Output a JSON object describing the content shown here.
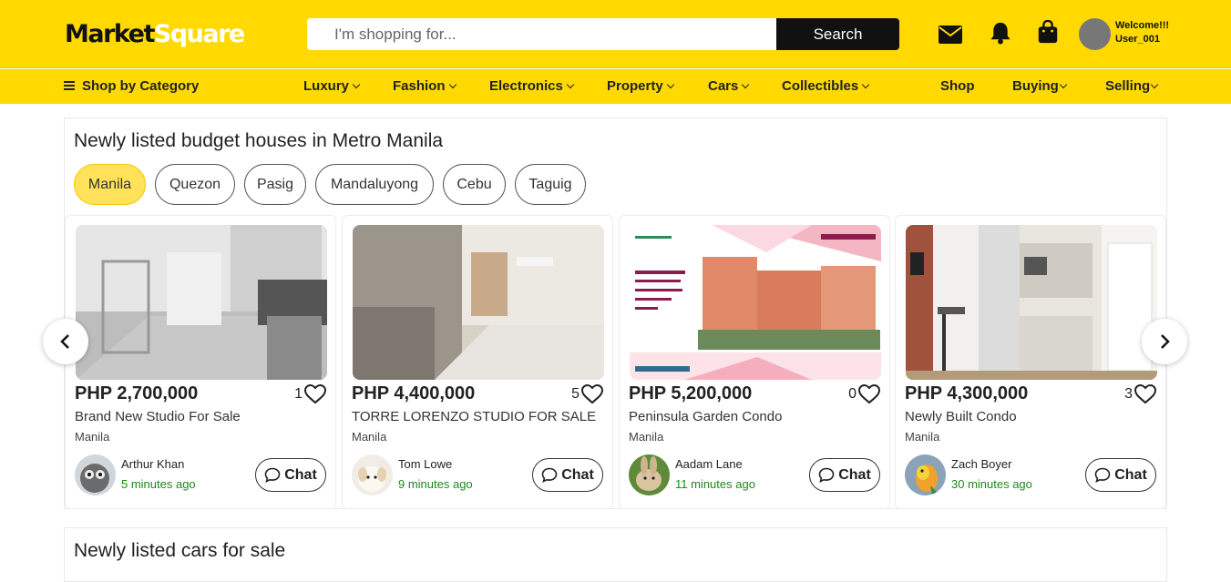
{
  "header": {
    "logo_part1": "Market",
    "logo_part2": "Square",
    "search_placeholder": "I'm shopping for...",
    "search_button": "Search",
    "welcome_line1": "Welcome!!!",
    "welcome_line2": "User_001",
    "brand_color": "#ffd900"
  },
  "nav": {
    "shop_by_category": "Shop by Category",
    "items": [
      {
        "label": "Luxury"
      },
      {
        "label": "Fashion"
      },
      {
        "label": "Electronics"
      },
      {
        "label": "Property"
      },
      {
        "label": "Cars"
      },
      {
        "label": "Collectibles"
      },
      {
        "label": "Shop"
      },
      {
        "label": "Buying"
      },
      {
        "label": "Selling"
      }
    ]
  },
  "section1": {
    "title": "Newly listed budget houses in Metro Manila",
    "filters": [
      "Manila",
      "Quezon",
      "Pasig",
      "Mandaluyong",
      "Cebu",
      "Taguig"
    ],
    "active_filter": "Manila",
    "cards": [
      {
        "price": "PHP 2,700,000",
        "likes": "1",
        "title": "Brand New Studio For Sale",
        "location": "Manila",
        "seller": "Arthur Khan",
        "time": "5 minutes ago",
        "chat": "Chat"
      },
      {
        "price": "PHP 4,400,000",
        "likes": "5",
        "title": "TORRE LORENZO STUDIO FOR SALE",
        "location": "Manila",
        "seller": "Tom Lowe",
        "time": "9 minutes ago",
        "chat": "Chat"
      },
      {
        "price": "PHP 5,200,000",
        "likes": "0",
        "title": "Peninsula Garden Condo",
        "location": "Manila",
        "seller": "Aadam Lane",
        "time": "11 minutes ago",
        "chat": "Chat"
      },
      {
        "price": "PHP 4,300,000",
        "likes": "3",
        "title": "Newly Built Condo",
        "location": "Manila",
        "seller": "Zach Boyer",
        "time": "30 minutes ago",
        "chat": "Chat"
      }
    ]
  },
  "section2": {
    "title": "Newly listed cars for sale"
  }
}
